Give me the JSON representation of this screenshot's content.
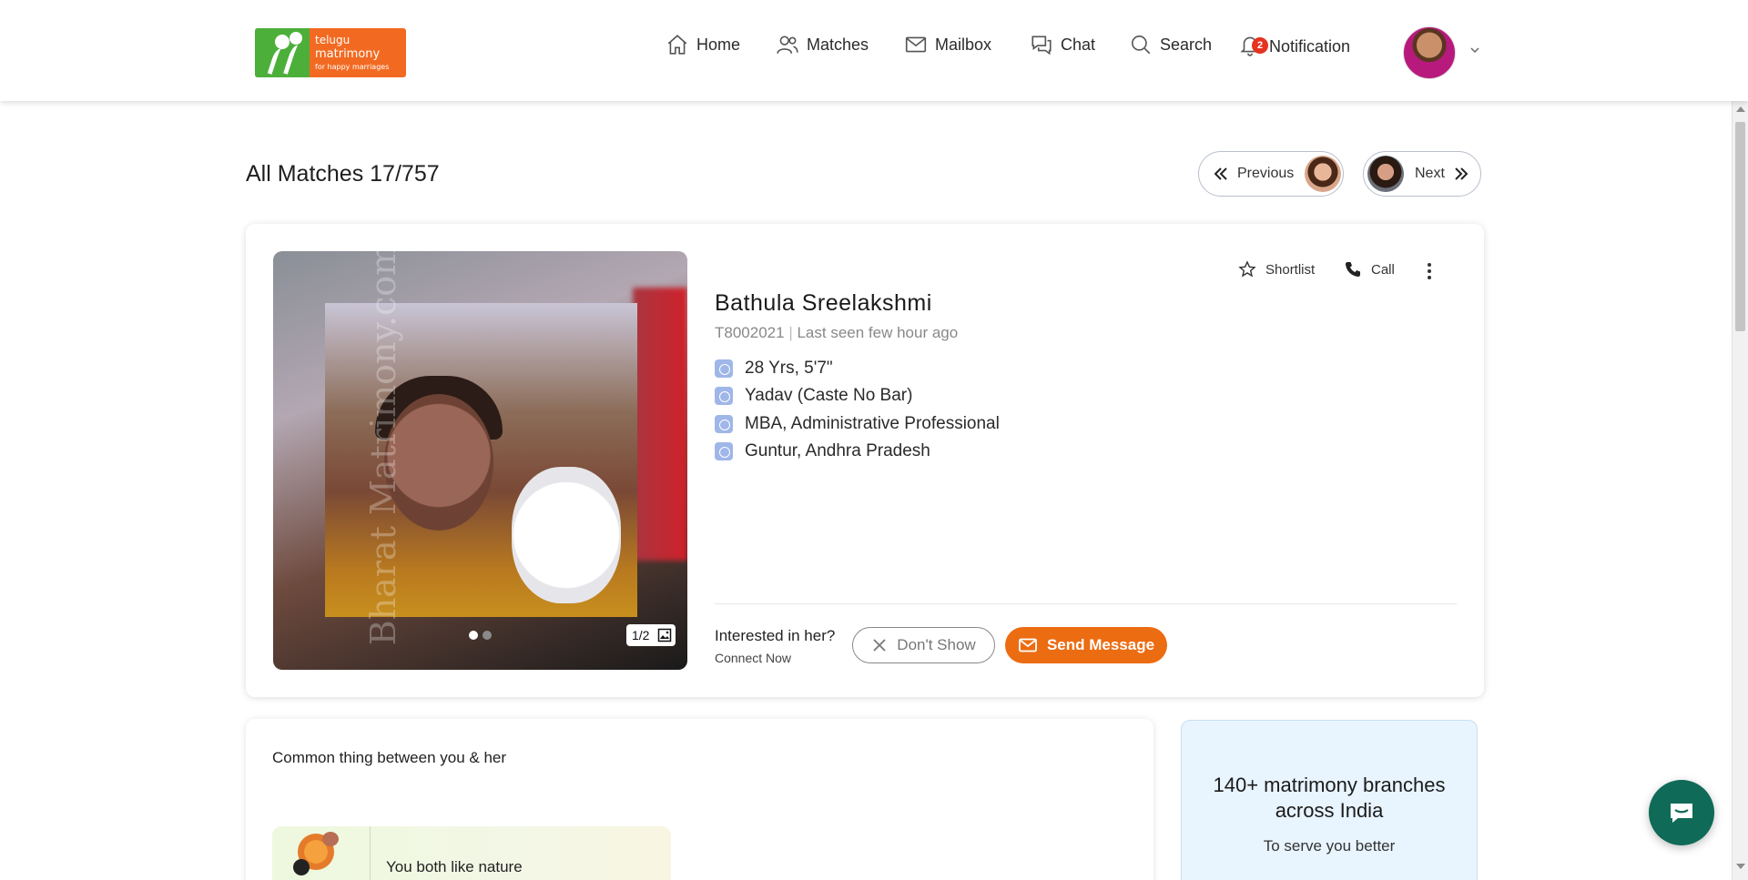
{
  "brand": {
    "logo_line1": "telugu",
    "logo_line2": "matrimony",
    "logo_tagline": "for happy marriages",
    "accent_orange": "#f26a21",
    "logo_green": "#4caf3a"
  },
  "nav": {
    "home": "Home",
    "matches": "Matches",
    "mailbox": "Mailbox",
    "chat": "Chat",
    "search": "Search",
    "notification": "Notification",
    "notification_count": "2"
  },
  "page": {
    "title": "All Matches 17/757",
    "previous_label": "Previous",
    "next_label": "Next"
  },
  "profile": {
    "name": "Bathula Sreelakshmi",
    "id": "T8002021",
    "separator": "|",
    "last_seen": "Last seen few hour ago",
    "age_height": "28 Yrs, 5'7\"",
    "caste": "Yadav (Caste No Bar)",
    "education_profession": "MBA, Administrative Professional",
    "location": "Guntur, Andhra Pradesh",
    "photo_watermark": "Bharat Matrimony.com",
    "photo_counter": "1/2",
    "photo_slides": 2,
    "active_slide": 1
  },
  "actions": {
    "shortlist": "Shortlist",
    "call": "Call",
    "interested_question": "Interested in her?",
    "connect_now": "Connect Now",
    "dont_show": "Don't Show",
    "send_message": "Send Message",
    "send_message_color": "#ec6c12"
  },
  "common": {
    "title": "Common thing between you & her",
    "items": [
      {
        "text": "You both like nature",
        "icon": "hobbies-icon"
      }
    ]
  },
  "promo": {
    "title": "140+ matrimony branches across India",
    "subtitle": "To serve you better"
  }
}
